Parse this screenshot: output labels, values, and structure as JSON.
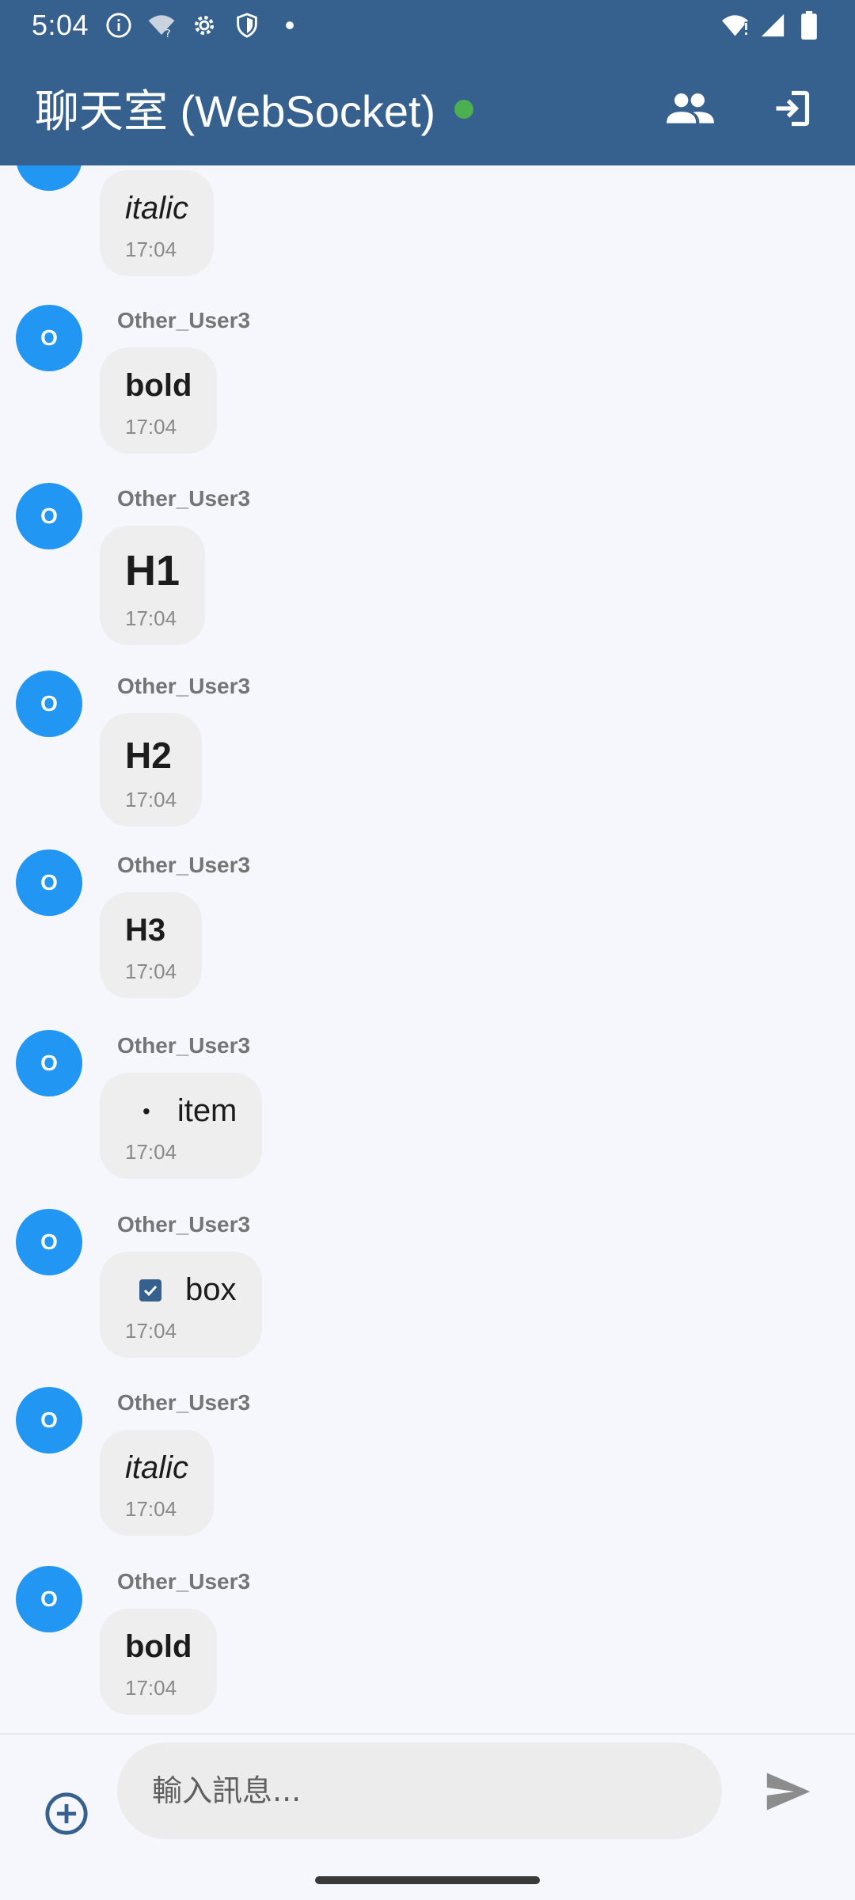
{
  "status_bar": {
    "time": "5:04",
    "left_icons": [
      "info-icon",
      "wifi-question-icon",
      "settings-icon",
      "shield-icon",
      "dot-icon"
    ],
    "right_icons": [
      "wifi-alert-icon",
      "signal-icon",
      "battery-icon"
    ]
  },
  "app_bar": {
    "title": "聊天室 (WebSocket)",
    "connection_status_color": "#4caf50",
    "actions": [
      "people-icon",
      "logout-icon"
    ]
  },
  "messages": [
    {
      "sender": "Other_User3",
      "avatar_letter": "O",
      "content": "bold",
      "style": "bold",
      "time": "17:04"
    },
    {
      "sender": "Other_User3",
      "avatar_letter": "O",
      "content": "H1",
      "style": "h1",
      "time": "17:04"
    },
    {
      "sender": "Other_User3",
      "avatar_letter": "O",
      "content": "H2",
      "style": "h2",
      "time": "17:04"
    },
    {
      "sender": "Other_User3",
      "avatar_letter": "O",
      "content": "H3",
      "style": "h3",
      "time": "17:04"
    },
    {
      "sender": "Other_User3",
      "avatar_letter": "O",
      "content": "item",
      "style": "bullet",
      "time": "17:04"
    },
    {
      "sender": "Other_User3",
      "avatar_letter": "O",
      "content": "box",
      "style": "checkbox",
      "time": "17:04"
    },
    {
      "sender": "Other_User3",
      "avatar_letter": "O",
      "content": "italic",
      "style": "italic",
      "time": "17:04"
    },
    {
      "sender": "Other_User3",
      "avatar_letter": "O",
      "content": "bold",
      "style": "bold",
      "time": "17:04"
    }
  ],
  "partial_top_message": {
    "content": "italic",
    "style": "italic",
    "time": "17:04"
  },
  "composer": {
    "placeholder": "輸入訊息...",
    "add_icon": "add-circle-icon",
    "send_icon": "send-icon"
  },
  "colors": {
    "primary": "#36618e",
    "avatar": "#2196f3",
    "bubble": "#eeeeee",
    "online": "#4caf50"
  }
}
